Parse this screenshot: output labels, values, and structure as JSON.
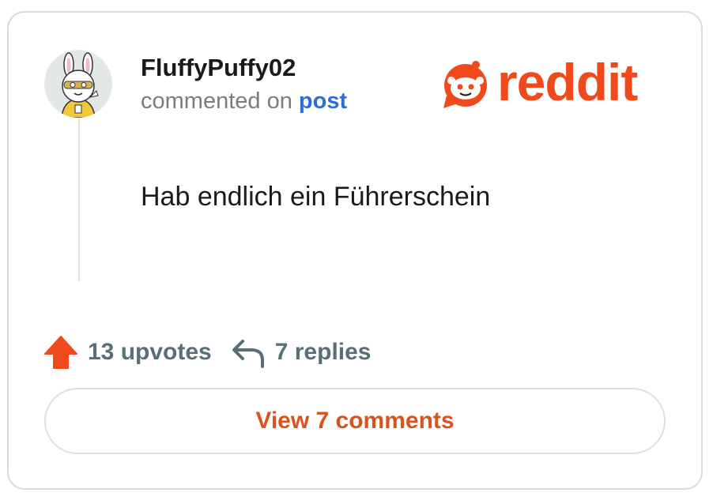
{
  "comment": {
    "username": "FluffyPuffy02",
    "action_text": "commented on",
    "post_link": "post",
    "body": "Hab endlich ein Führerschein"
  },
  "brand": {
    "wordmark": "reddit",
    "color": "#f04a1c"
  },
  "stats": {
    "upvotes": "13 upvotes",
    "replies": "7 replies"
  },
  "actions": {
    "view_comments_label": "View 7 comments"
  },
  "icons": {
    "avatar": "avatar-bunny-hood",
    "logo": "reddit-snoo-icon",
    "upvote": "upvote-arrow-icon",
    "reply": "reply-arrow-icon"
  },
  "colors": {
    "accent": "#d9531e",
    "link": "#2f6ed7",
    "muted": "#576f76"
  }
}
